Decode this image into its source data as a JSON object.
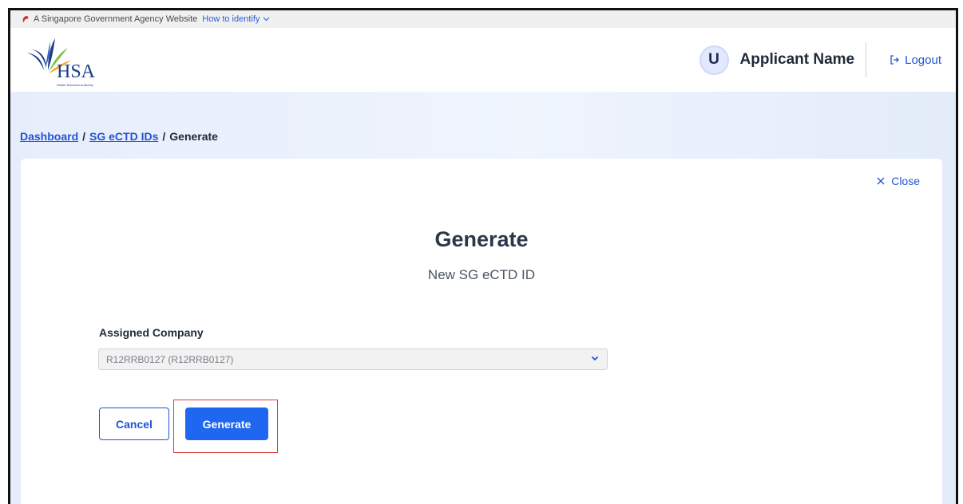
{
  "masthead": {
    "text": "A Singapore Government Agency Website",
    "identify": "How to identify"
  },
  "header": {
    "logo_text": "HSA",
    "logo_subtext": "Health Sciences Authority",
    "avatar_initial": "U",
    "user_name": "Applicant Name",
    "logout_label": "Logout"
  },
  "breadcrumb": {
    "items": [
      "Dashboard",
      "SG eCTD IDs",
      "Generate"
    ],
    "separator": "/"
  },
  "card": {
    "close_label": "Close",
    "title": "Generate",
    "subtitle": "New SG eCTD ID",
    "field_label": "Assigned Company",
    "select_value": "R12RRB0127 (R12RRB0127)",
    "cancel_label": "Cancel",
    "generate_label": "Generate"
  },
  "colors": {
    "accent": "#2353d4",
    "primary_button": "#1f66f0",
    "highlight": "#e03a3a",
    "band": "#eaf0fb"
  },
  "icons": {
    "masthead": "lion-head-icon",
    "identify": "chevron-down-icon",
    "logout": "logout-icon",
    "close": "close-icon",
    "select": "chevron-down-icon"
  }
}
